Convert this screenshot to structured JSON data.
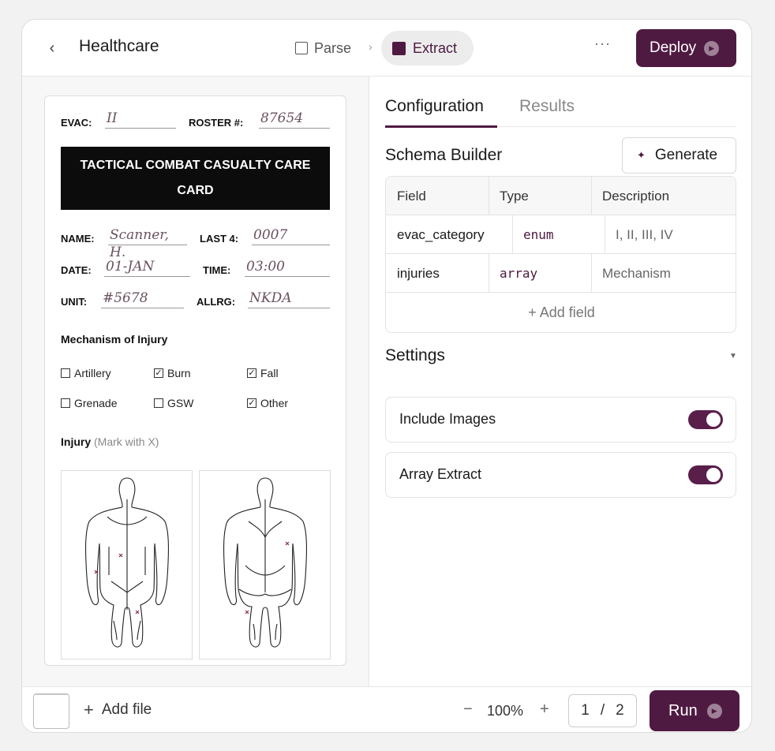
{
  "header": {
    "title": "Healthcare",
    "steps": [
      {
        "label": "Parse"
      },
      {
        "label": "Extract"
      }
    ],
    "deploy_label": "Deploy"
  },
  "card": {
    "evac_label": "EVAC:",
    "evac_value": "II",
    "roster_label": "ROSTER #:",
    "roster_value": "87654",
    "banner": "TACTICAL COMBAT CASUALTY CARE CARD",
    "name_label": "NAME:",
    "name_value": "Scanner, H.",
    "last4_label": "LAST 4:",
    "last4_value": "0007",
    "date_label": "DATE:",
    "date_value": "01-JAN",
    "time_label": "TIME:",
    "time_value": "03:00",
    "unit_label": "UNIT:",
    "unit_value": "#5678",
    "allrg_label": "ALLRG:",
    "allrg_value": "NKDA",
    "moi_title": "Mechanism of Injury",
    "mechanisms": [
      {
        "label": "Artillery",
        "checked": false
      },
      {
        "label": "Burn",
        "checked": true
      },
      {
        "label": "Fall",
        "checked": true
      },
      {
        "label": "Grenade",
        "checked": false
      },
      {
        "label": "GSW",
        "checked": false
      },
      {
        "label": "Other",
        "checked": true
      }
    ],
    "injury_title": "Injury",
    "injury_note": "(Mark with X)"
  },
  "tabs": [
    {
      "label": "Configuration",
      "active": true
    },
    {
      "label": "Results",
      "active": false
    }
  ],
  "schema": {
    "title": "Schema Builder",
    "generate_label": "Generate",
    "columns": [
      "Field",
      "Type",
      "Description"
    ],
    "rows": [
      {
        "field": "evac_category",
        "type": "enum",
        "description": "I, II, III, IV"
      },
      {
        "field": "injuries",
        "type": "array",
        "description": "Mechanism"
      }
    ],
    "add_field_label": "+ Add field"
  },
  "settings": {
    "title": "Settings",
    "items": [
      {
        "label": "Include Images",
        "on": true
      },
      {
        "label": "Array Extract",
        "on": true
      }
    ]
  },
  "footer": {
    "add_file_label": "Add file",
    "zoom": "100%",
    "page_current": "1",
    "page_separator": "/",
    "page_total": "2",
    "run_label": "Run"
  },
  "colors": {
    "accent": "#4f1a42",
    "injury_mark": "#8a2a5a"
  }
}
